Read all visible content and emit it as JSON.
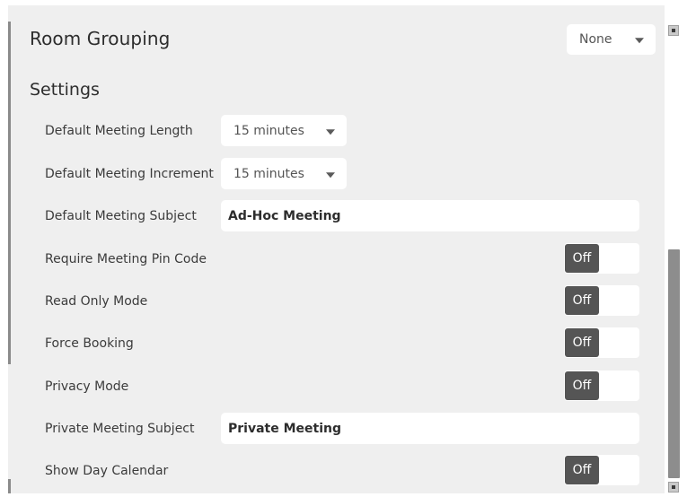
{
  "room_grouping": {
    "label": "Room Grouping",
    "selected": "None"
  },
  "settings": {
    "title": "Settings",
    "rows": [
      {
        "label": "Default Meeting Length",
        "type": "select",
        "value": "15 minutes"
      },
      {
        "label": "Default Meeting Increment",
        "type": "select",
        "value": "15 minutes"
      },
      {
        "label": "Default Meeting Subject",
        "type": "text",
        "value": "Ad-Hoc Meeting"
      },
      {
        "label": "Require Meeting Pin Code",
        "type": "toggle",
        "value": "Off"
      },
      {
        "label": "Read Only Mode",
        "type": "toggle",
        "value": "Off"
      },
      {
        "label": "Force Booking",
        "type": "toggle",
        "value": "Off"
      },
      {
        "label": "Privacy Mode",
        "type": "toggle",
        "value": "Off"
      },
      {
        "label": "Private Meeting Subject",
        "type": "text",
        "value": "Private Meeting"
      },
      {
        "label": "Show Day Calendar",
        "type": "toggle",
        "value": "Off"
      }
    ]
  },
  "colors": {
    "panel_bg": "#efefef",
    "toggle_off_knob": "#555555",
    "input_bg": "#ffffff"
  }
}
